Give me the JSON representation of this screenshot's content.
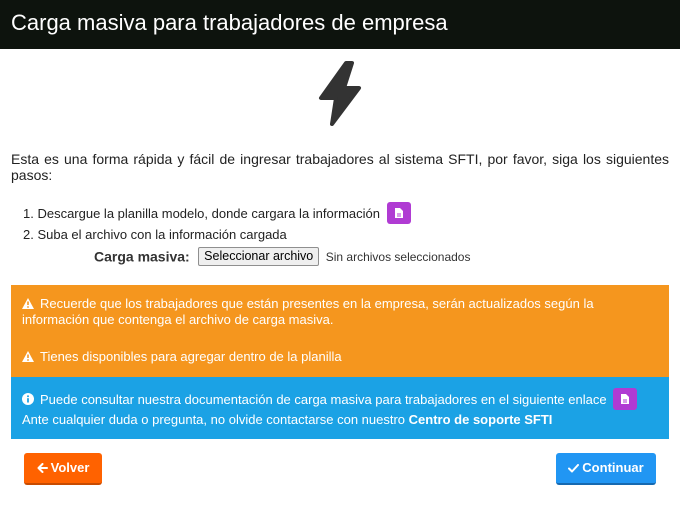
{
  "header": {
    "title": "Carga masiva para trabajadores de empresa"
  },
  "intro": {
    "text": "Esta es una forma rápida y fácil de ingresar trabajadores al sistema SFTI, por favor, siga los siguientes pasos:"
  },
  "steps": [
    "1. Descargue la planilla modelo, donde cargara la información",
    "2. Suba el archivo con la información cargada"
  ],
  "upload": {
    "label": "Carga masiva:",
    "button_label": "Seleccionar archivo",
    "status": "Sin archivos seleccionados"
  },
  "alerts": {
    "warning1": "Recuerde que los trabajadores que están presentes en la empresa, serán actualizados según la información que contenga el archivo de carga masiva.",
    "warning2": "Tienes disponibles para agregar dentro de la planilla",
    "info_line1": "Puede consultar nuestra documentación de carga masiva para trabajadores en el siguiente enlace",
    "info_line2_prefix": "Ante cualquier duda o pregunta, no olvide contactarse con nuestro",
    "info_line2_strong": "Centro de soporte SFTI"
  },
  "buttons": {
    "back": "Volver",
    "continue": "Continuar"
  },
  "colors": {
    "header_bg": "#0d130d",
    "warning_bg": "#f5961e",
    "info_bg": "#1ba2e5",
    "doc_button": "#b03bd3",
    "back_button": "#ff6200",
    "continue_button": "#2196f3"
  },
  "icons": [
    "bolt-icon",
    "file-icon",
    "warning-icon",
    "info-icon",
    "arrow-left-icon",
    "check-icon"
  ]
}
